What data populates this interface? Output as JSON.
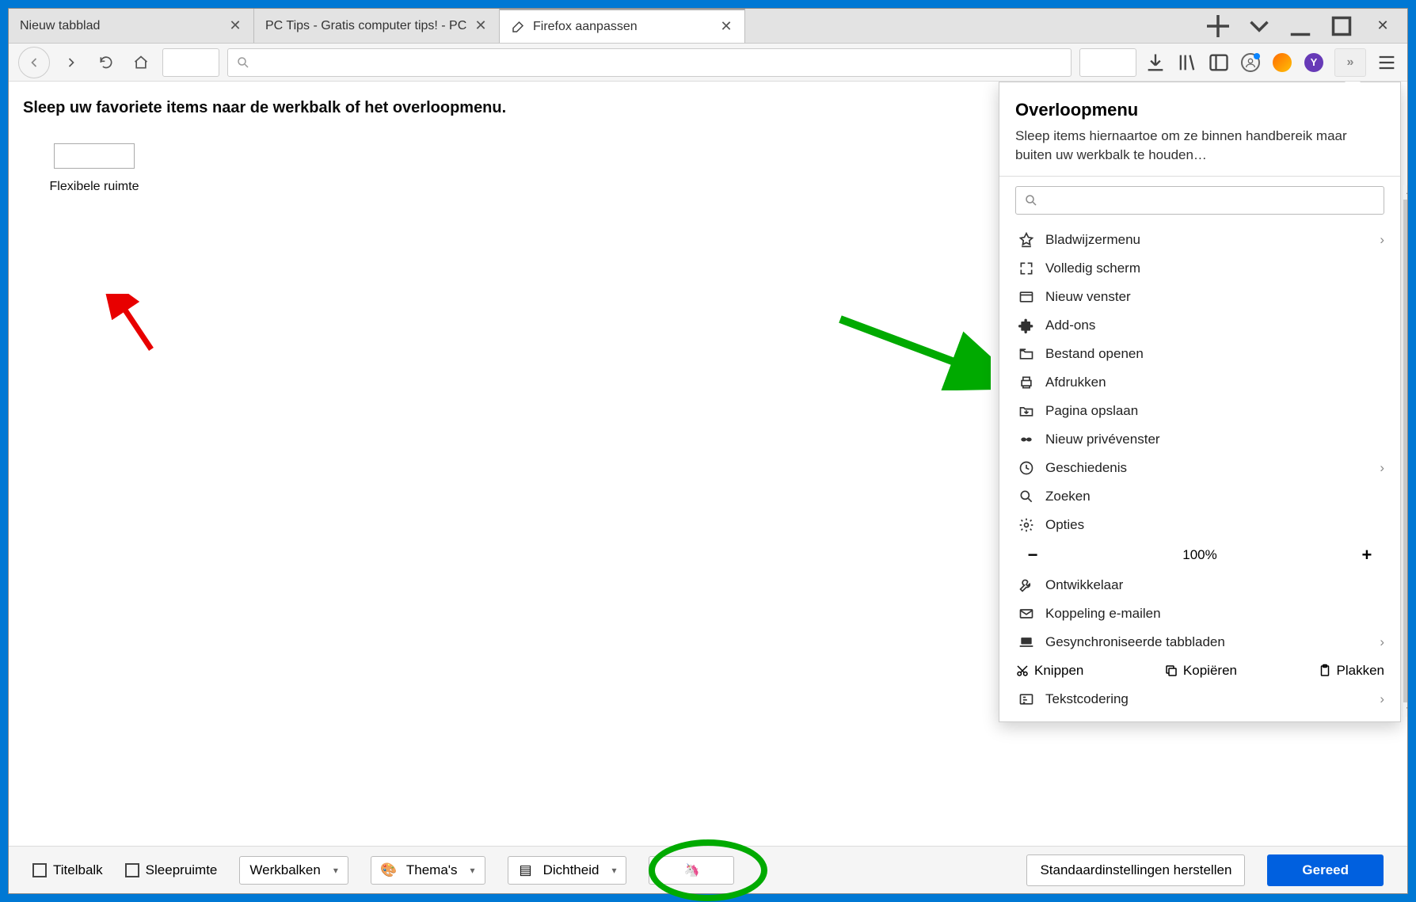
{
  "tabs": [
    {
      "title": "Nieuw tabblad"
    },
    {
      "title": "PC Tips - Gratis computer tips! - PC"
    },
    {
      "title": "Firefox aanpassen",
      "active": true
    }
  ],
  "toolbar": {
    "search_placeholder": ""
  },
  "customize": {
    "instructions": "Sleep uw favoriete items naar de werkbalk of het overloopmenu.",
    "palette_item_label": "Flexibele ruimte"
  },
  "panel": {
    "title": "Overloopmenu",
    "description": "Sleep items hiernaartoe om ze binnen handbereik maar buiten uw werkbalk te houden…",
    "items": [
      {
        "label": "Bladwijzermenu",
        "icon": "bookmark",
        "chevron": true
      },
      {
        "label": "Volledig scherm",
        "icon": "fullscreen"
      },
      {
        "label": "Nieuw venster",
        "icon": "window"
      },
      {
        "label": "Add-ons",
        "icon": "puzzle"
      },
      {
        "label": "Bestand openen",
        "icon": "open"
      },
      {
        "label": "Afdrukken",
        "icon": "print"
      },
      {
        "label": "Pagina opslaan",
        "icon": "save"
      },
      {
        "label": "Nieuw privévenster",
        "icon": "mask"
      },
      {
        "label": "Geschiedenis",
        "icon": "clock",
        "chevron": true
      },
      {
        "label": "Zoeken",
        "icon": "search"
      },
      {
        "label": "Opties",
        "icon": "gear"
      }
    ],
    "zoom_label": "100%",
    "items2": [
      {
        "label": "Ontwikkelaar",
        "icon": "wrench"
      },
      {
        "label": "Koppeling e-mailen",
        "icon": "mail"
      },
      {
        "label": "Gesynchroniseerde tabbladen",
        "icon": "laptop",
        "chevron": true
      }
    ],
    "edit": {
      "cut": "Knippen",
      "copy": "Kopiëren",
      "paste": "Plakken"
    },
    "items3": [
      {
        "label": "Tekstcodering",
        "icon": "encoding",
        "chevron": true
      }
    ]
  },
  "bottom": {
    "titlebar": "Titelbalk",
    "dragspace": "Sleepruimte",
    "toolbars": "Werkbalken",
    "themes": "Thema's",
    "density": "Dichtheid",
    "restore": "Standaardinstellingen herstellen",
    "done": "Gereed"
  }
}
